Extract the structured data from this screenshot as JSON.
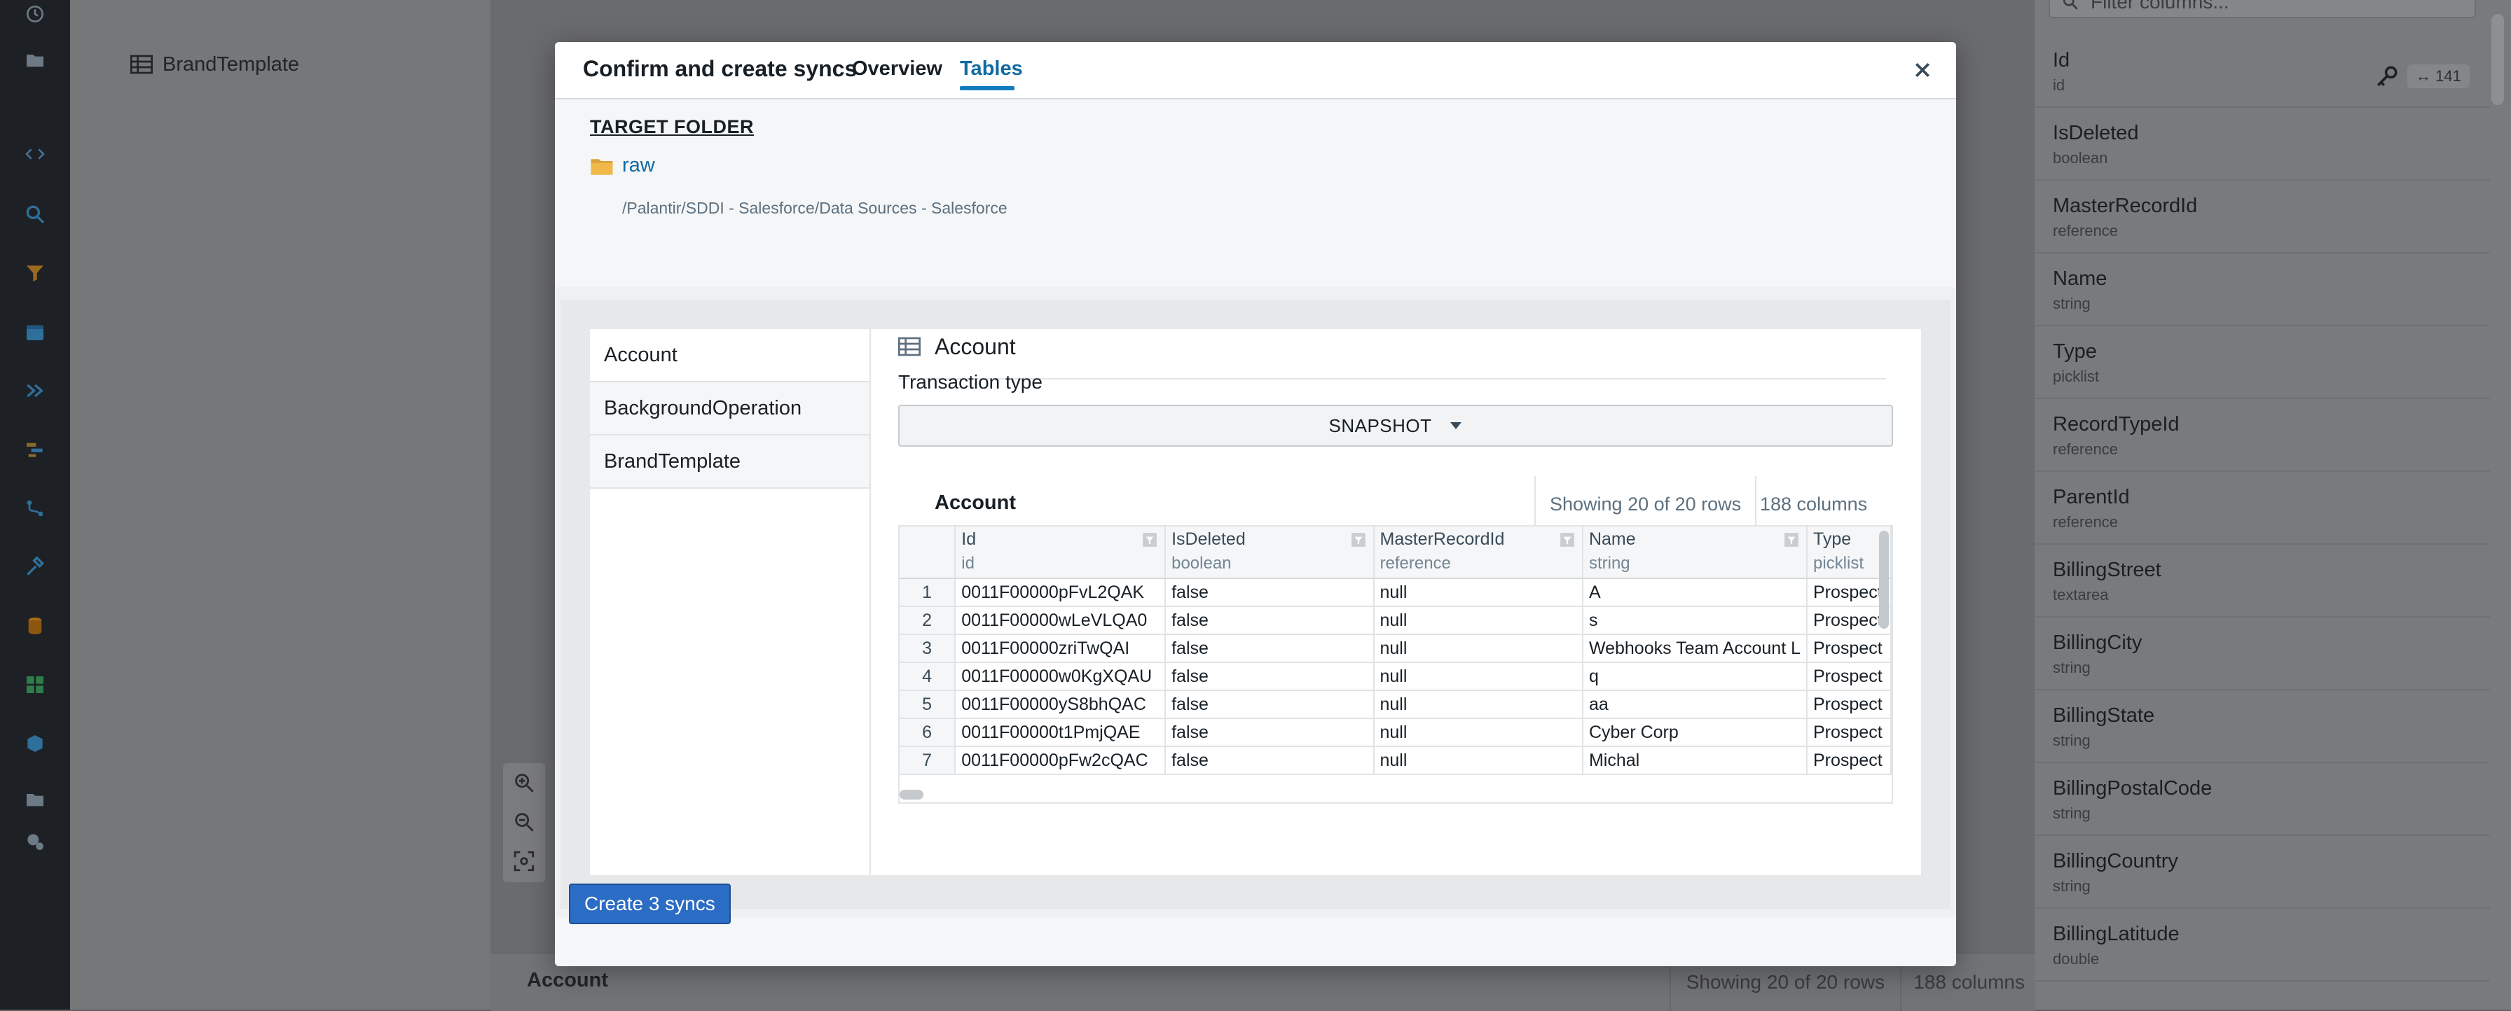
{
  "background": {
    "tree_item": "BrandTemplate",
    "bottom_bar": {
      "title": "Account",
      "rows": "Showing 20 of 20 rows",
      "columns": "188 columns"
    },
    "right_panel": {
      "filter_placeholder": "Filter columns...",
      "column_count": "141",
      "columns": [
        {
          "name": "Id",
          "type": "id"
        },
        {
          "name": "IsDeleted",
          "type": "boolean"
        },
        {
          "name": "MasterRecordId",
          "type": "reference"
        },
        {
          "name": "Name",
          "type": "string"
        },
        {
          "name": "Type",
          "type": "picklist"
        },
        {
          "name": "RecordTypeId",
          "type": "reference"
        },
        {
          "name": "ParentId",
          "type": "reference"
        },
        {
          "name": "BillingStreet",
          "type": "textarea"
        },
        {
          "name": "BillingCity",
          "type": "string"
        },
        {
          "name": "BillingState",
          "type": "string"
        },
        {
          "name": "BillingPostalCode",
          "type": "string"
        },
        {
          "name": "BillingCountry",
          "type": "string"
        },
        {
          "name": "BillingLatitude",
          "type": "double"
        }
      ]
    }
  },
  "modal": {
    "title": "Confirm and create syncs",
    "tabs": [
      {
        "label": "Overview"
      },
      {
        "label": "Tables"
      }
    ],
    "target_folder": {
      "label": "TARGET FOLDER",
      "name": "raw",
      "path": "/Palantir/SDDI - Salesforce/Data Sources - Salesforce"
    },
    "tables": [
      "Account",
      "BackgroundOperation",
      "BrandTemplate"
    ],
    "detail": {
      "title": "Account",
      "transaction_type_label": "Transaction type",
      "transaction_type_value": "SNAPSHOT",
      "preview": {
        "title": "Account",
        "rows": "Showing 20 of 20 rows",
        "columns": "188 columns",
        "headers": [
          {
            "name": "Id",
            "type": "id"
          },
          {
            "name": "IsDeleted",
            "type": "boolean"
          },
          {
            "name": "MasterRecordId",
            "type": "reference"
          },
          {
            "name": "Name",
            "type": "string"
          },
          {
            "name": "Type",
            "type": "picklist"
          }
        ],
        "rows_data": [
          [
            "1",
            "0011F00000pFvL2QAK",
            "false",
            "null",
            "A",
            "Prospect"
          ],
          [
            "2",
            "0011F00000wLeVLQA0",
            "false",
            "null",
            "s",
            "Prospect"
          ],
          [
            "3",
            "0011F00000zriTwQAI",
            "false",
            "null",
            "Webhooks Team Account L",
            "Prospect"
          ],
          [
            "4",
            "0011F00000w0KgXQAU",
            "false",
            "null",
            "q",
            "Prospect"
          ],
          [
            "5",
            "0011F00000yS8bhQAC",
            "false",
            "null",
            "aa",
            "Prospect"
          ],
          [
            "6",
            "0011F00000t1PmjQAE",
            "false",
            "null",
            "Cyber Corp",
            "Prospect"
          ],
          [
            "7",
            "0011F00000pFw2cQAC",
            "false",
            "null",
            "Michal",
            "Prospect"
          ]
        ]
      }
    },
    "create_button": "Create 3 syncs"
  }
}
